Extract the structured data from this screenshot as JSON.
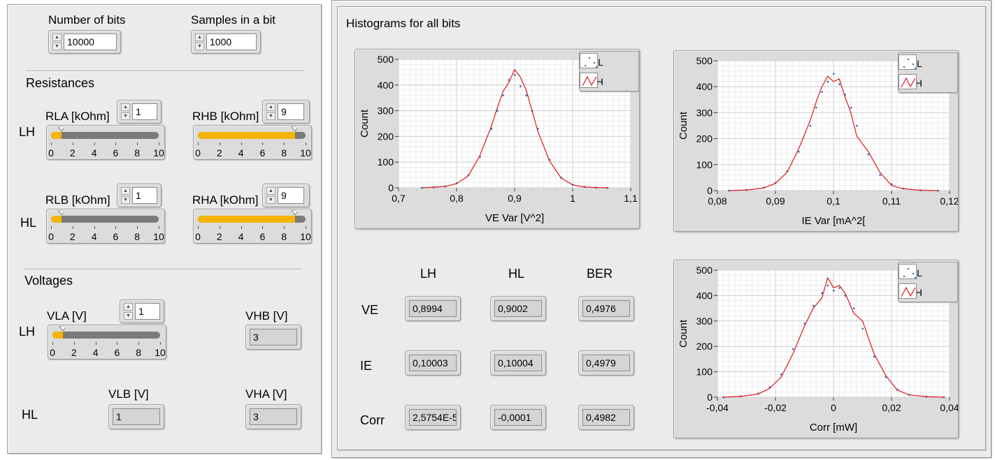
{
  "controls": {
    "num_bits": {
      "label": "Number of bits",
      "value": "10000"
    },
    "samples": {
      "label": "Samples in a bit",
      "value": "1000"
    }
  },
  "resistances": {
    "title": "Resistances",
    "lh_label": "LH",
    "hl_label": "HL",
    "rla": {
      "label": "RLA [kOhm]",
      "value": "1",
      "level": 1
    },
    "rhb": {
      "label": "RHB [kOhm]",
      "value": "9",
      "level": 9
    },
    "rlb": {
      "label": "RLB [kOhm]",
      "value": "1",
      "level": 1
    },
    "rha": {
      "label": "RHA [kOhm]",
      "value": "9",
      "level": 9
    },
    "scale": [
      "0",
      "2",
      "4",
      "6",
      "8",
      "10"
    ]
  },
  "voltages": {
    "title": "Voltages",
    "lh_label": "LH",
    "hl_label": "HL",
    "vla": {
      "label": "VLA [V]",
      "value": "1",
      "level": 1
    },
    "vhb": {
      "label": "VHB [V]",
      "value": "3"
    },
    "vlb": {
      "label": "VLB [V]",
      "value": "1"
    },
    "vha": {
      "label": "VHA [V]",
      "value": "3"
    }
  },
  "histograms": {
    "title": "Histograms for all bits",
    "table": {
      "col_headers": [
        "LH",
        "HL",
        "BER"
      ],
      "rows": [
        {
          "label": "VE",
          "values": [
            "0,8994",
            "0,9002",
            "0,4976"
          ]
        },
        {
          "label": "IE",
          "values": [
            "0,10003",
            "0,10004",
            "0,4979"
          ]
        },
        {
          "label": "Corr",
          "values": [
            "2,5754E-5",
            "-0,0001",
            "0,4982"
          ]
        }
      ]
    }
  },
  "colors": {
    "accent": "#f5b400",
    "hl_series": "#1f6fb0",
    "lh_series": "#e0141c"
  },
  "chart_data": [
    {
      "type": "scatter",
      "xlabel": "VE Var [V^2]",
      "ylabel": "Count",
      "xlim": [
        0.7,
        1.1
      ],
      "ylim": [
        0,
        500
      ],
      "xticks": [
        "0,7",
        "0,8",
        "0,9",
        "1",
        "1,1"
      ],
      "yticks": [
        "0",
        "100",
        "200",
        "300",
        "400",
        "500"
      ],
      "grid": true,
      "legend_position": "top-right",
      "series": [
        {
          "name": "HL",
          "style": "points",
          "x": [
            0.74,
            0.76,
            0.78,
            0.8,
            0.82,
            0.84,
            0.86,
            0.87,
            0.88,
            0.89,
            0.9,
            0.91,
            0.92,
            0.93,
            0.94,
            0.96,
            0.98,
            1.0,
            1.02,
            1.04,
            1.06
          ],
          "values": [
            0,
            2,
            6,
            18,
            50,
            120,
            230,
            300,
            360,
            420,
            440,
            395,
            360,
            300,
            230,
            110,
            40,
            12,
            4,
            1,
            0
          ]
        },
        {
          "name": "LH",
          "style": "line",
          "x": [
            0.74,
            0.76,
            0.78,
            0.8,
            0.82,
            0.84,
            0.86,
            0.87,
            0.88,
            0.89,
            0.9,
            0.91,
            0.92,
            0.93,
            0.94,
            0.96,
            0.98,
            1.0,
            1.02,
            1.04,
            1.06
          ],
          "values": [
            0,
            2,
            5,
            16,
            46,
            125,
            240,
            310,
            375,
            410,
            460,
            430,
            380,
            300,
            220,
            105,
            38,
            11,
            3,
            1,
            0
          ]
        }
      ]
    },
    {
      "type": "scatter",
      "xlabel": "IE Var [mA^2[",
      "ylabel": "Count",
      "xlim": [
        0.08,
        0.12
      ],
      "ylim": [
        0,
        500
      ],
      "xticks": [
        "0,08",
        "0,09",
        "0,1",
        "0,11",
        "0,12"
      ],
      "yticks": [
        "0",
        "100",
        "200",
        "300",
        "400",
        "500"
      ],
      "grid": true,
      "legend_position": "top-right",
      "series": [
        {
          "name": "HL",
          "style": "points",
          "x": [
            0.082,
            0.085,
            0.088,
            0.09,
            0.092,
            0.094,
            0.096,
            0.097,
            0.098,
            0.099,
            0.1,
            0.101,
            0.102,
            0.103,
            0.104,
            0.106,
            0.108,
            0.11,
            0.112,
            0.115,
            0.118
          ],
          "values": [
            0,
            3,
            12,
            30,
            75,
            150,
            250,
            320,
            380,
            420,
            450,
            410,
            370,
            320,
            250,
            140,
            60,
            25,
            8,
            2,
            0
          ]
        },
        {
          "name": "LH",
          "style": "line",
          "x": [
            0.082,
            0.085,
            0.088,
            0.09,
            0.092,
            0.094,
            0.096,
            0.097,
            0.098,
            0.099,
            0.1,
            0.101,
            0.102,
            0.103,
            0.104,
            0.106,
            0.108,
            0.11,
            0.112,
            0.115,
            0.118
          ],
          "values": [
            0,
            2,
            10,
            28,
            70,
            160,
            270,
            340,
            400,
            440,
            420,
            430,
            360,
            300,
            210,
            150,
            70,
            20,
            7,
            1,
            0
          ]
        }
      ]
    },
    {
      "type": "scatter",
      "xlabel": "Corr [mW]",
      "ylabel": "Count",
      "xlim": [
        -0.04,
        0.04
      ],
      "ylim": [
        0,
        500
      ],
      "xticks": [
        "-0,04",
        "-0,02",
        "0",
        "0,02",
        "0,04"
      ],
      "yticks": [
        "0",
        "100",
        "200",
        "300",
        "400",
        "500"
      ],
      "grid": true,
      "legend_position": "top-right",
      "series": [
        {
          "name": "HL",
          "style": "points",
          "x": [
            -0.038,
            -0.032,
            -0.026,
            -0.022,
            -0.018,
            -0.014,
            -0.01,
            -0.007,
            -0.004,
            -0.002,
            0.0,
            0.002,
            0.004,
            0.007,
            0.01,
            0.014,
            0.018,
            0.022,
            0.026,
            0.032,
            0.038
          ],
          "values": [
            0,
            4,
            15,
            40,
            90,
            190,
            290,
            360,
            410,
            440,
            420,
            430,
            400,
            350,
            270,
            160,
            80,
            30,
            10,
            2,
            0
          ]
        },
        {
          "name": "LH",
          "style": "line",
          "x": [
            -0.038,
            -0.032,
            -0.026,
            -0.022,
            -0.018,
            -0.014,
            -0.01,
            -0.007,
            -0.004,
            -0.002,
            0.0,
            0.002,
            0.004,
            0.007,
            0.01,
            0.014,
            0.018,
            0.022,
            0.026,
            0.032,
            0.038
          ],
          "values": [
            0,
            3,
            12,
            35,
            80,
            170,
            280,
            350,
            390,
            470,
            430,
            440,
            410,
            330,
            300,
            170,
            85,
            28,
            9,
            2,
            0
          ]
        }
      ]
    }
  ]
}
